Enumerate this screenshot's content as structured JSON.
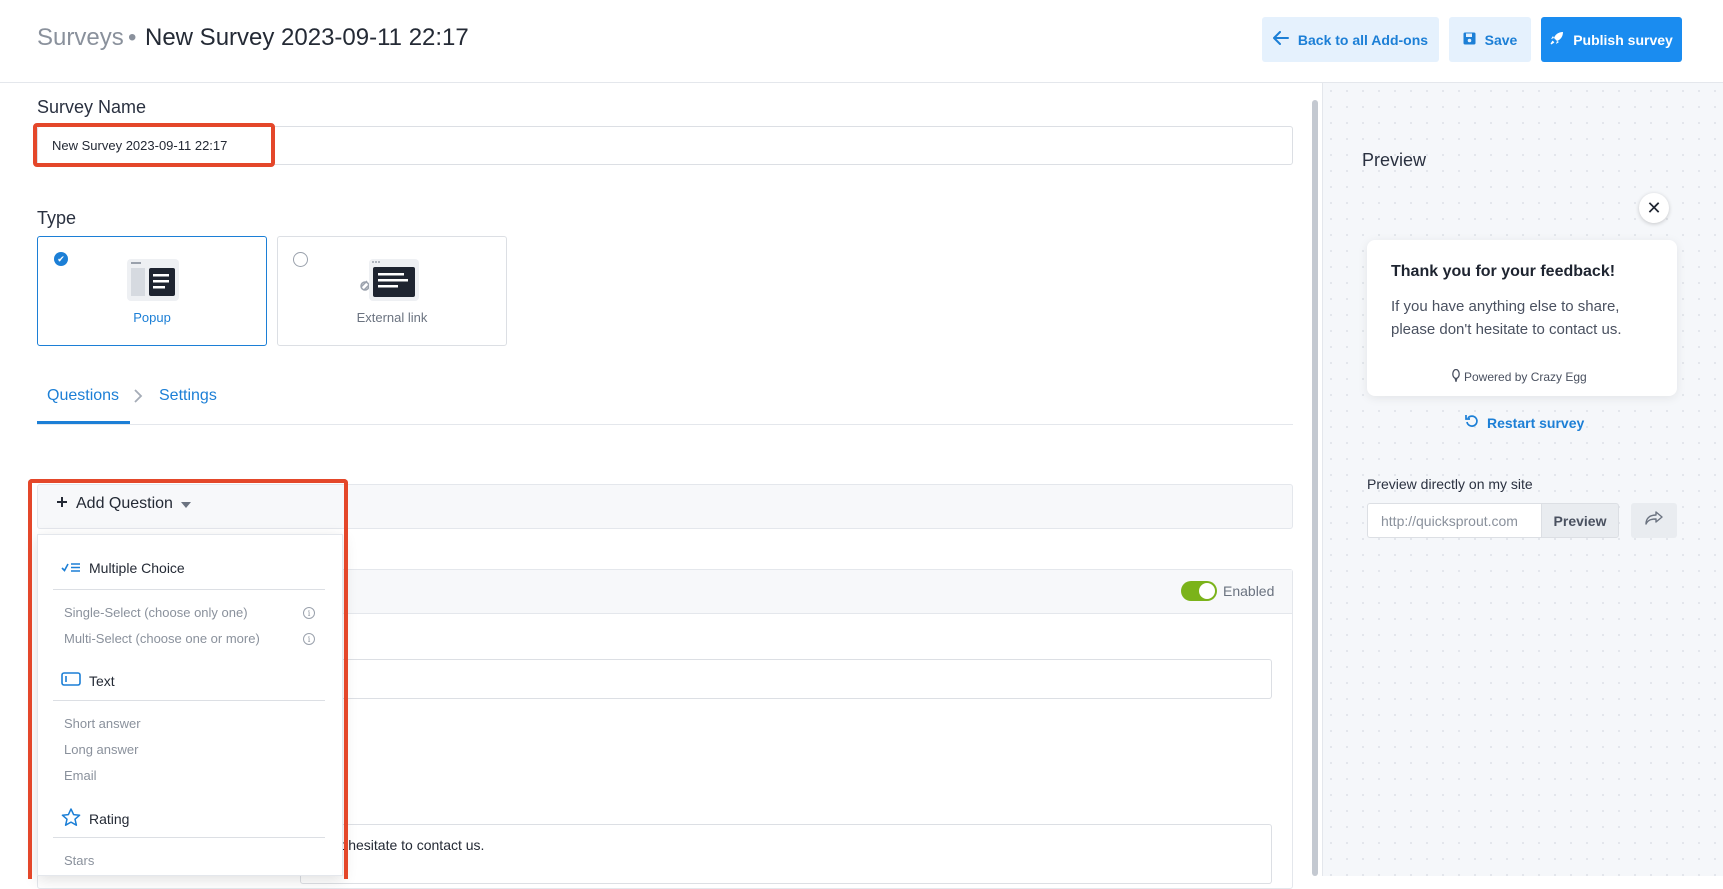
{
  "header": {
    "breadcrumb_root": "Surveys",
    "breadcrumb_sep": "•",
    "title": "New Survey 2023-09-11 22:17",
    "back_label": "Back to all Add-ons",
    "save_label": "Save",
    "publish_label": "Publish survey"
  },
  "form": {
    "name_label": "Survey Name",
    "name_value": "New Survey 2023-09-11 22:17",
    "type_label": "Type",
    "types": [
      {
        "label": "Popup",
        "selected": true
      },
      {
        "label": "External link",
        "selected": false
      }
    ]
  },
  "tabs": [
    {
      "label": "Questions",
      "active": true
    },
    {
      "label": "Settings",
      "active": false
    }
  ],
  "add_question": {
    "label": "Add Question",
    "groups": [
      {
        "title": "Multiple Choice",
        "icon": "multiple-choice-icon",
        "items": [
          "Single-Select (choose only one)",
          "Multi-Select (choose one or more)"
        ]
      },
      {
        "title": "Text",
        "icon": "text-field-icon",
        "items": [
          "Short answer",
          "Long answer",
          "Email"
        ]
      },
      {
        "title": "Rating",
        "icon": "star-icon",
        "items": [
          "Stars"
        ]
      }
    ]
  },
  "question_card": {
    "toggle_label": "Enabled",
    "enabled": true,
    "text_fragment": "n't hesitate to contact us."
  },
  "preview": {
    "title": "Preview",
    "card_title": "Thank you for your feedback!",
    "card_body": "If you have anything else to share, please don't hesitate to contact us.",
    "powered_by": "Powered by Crazy Egg",
    "restart_label": "Restart survey",
    "direct_label": "Preview directly on my site",
    "url_placeholder": "http://quicksprout.com",
    "preview_button": "Preview"
  },
  "colors": {
    "accent": "#1c7fd6",
    "primary_button": "#1a8cf0",
    "highlight": "#e4472a",
    "toggle_on": "#7bb31a"
  }
}
